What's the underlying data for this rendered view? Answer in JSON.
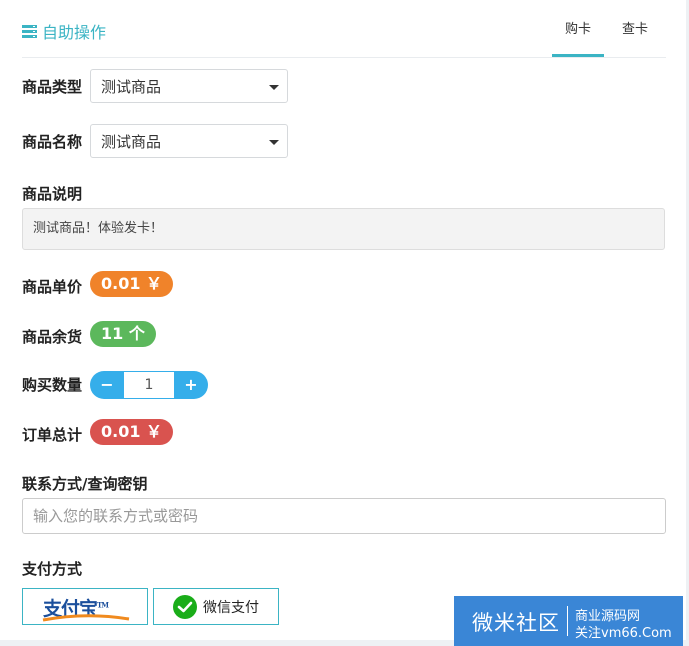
{
  "header": {
    "title": "自助操作",
    "tabs": [
      {
        "label": "购卡",
        "active": true
      },
      {
        "label": "查卡",
        "active": false
      }
    ]
  },
  "form": {
    "type_label": "商品类型",
    "type_value": "测试商品",
    "name_label": "商品名称",
    "name_value": "测试商品",
    "desc_label": "商品说明",
    "desc_value": "测试商品！体验发卡！",
    "price_label": "商品单价",
    "price_value": "0.01 ￥",
    "stock_label": "商品余货",
    "stock_value": "11 个",
    "qty_label": "购买数量",
    "qty_minus": "−",
    "qty_value": "1",
    "qty_plus": "+",
    "total_label": "订单总计",
    "total_value": "0.01 ￥",
    "contact_label": "联系方式/查询密钥",
    "contact_placeholder": "输入您的联系方式或密码",
    "payment_label": "支付方式",
    "alipay_logo": "支付宝",
    "alipay_tm": "TM",
    "wechat_label": "微信支付"
  },
  "watermark": {
    "main": "微米社区",
    "line1": "商业源码网",
    "line2": "关注vm66.Com"
  },
  "colors": {
    "accent": "#3bb4c4",
    "price_badge": "#f0832a",
    "stock_badge": "#5cb85c",
    "total_badge": "#d9534f",
    "stepper": "#35aeea"
  }
}
